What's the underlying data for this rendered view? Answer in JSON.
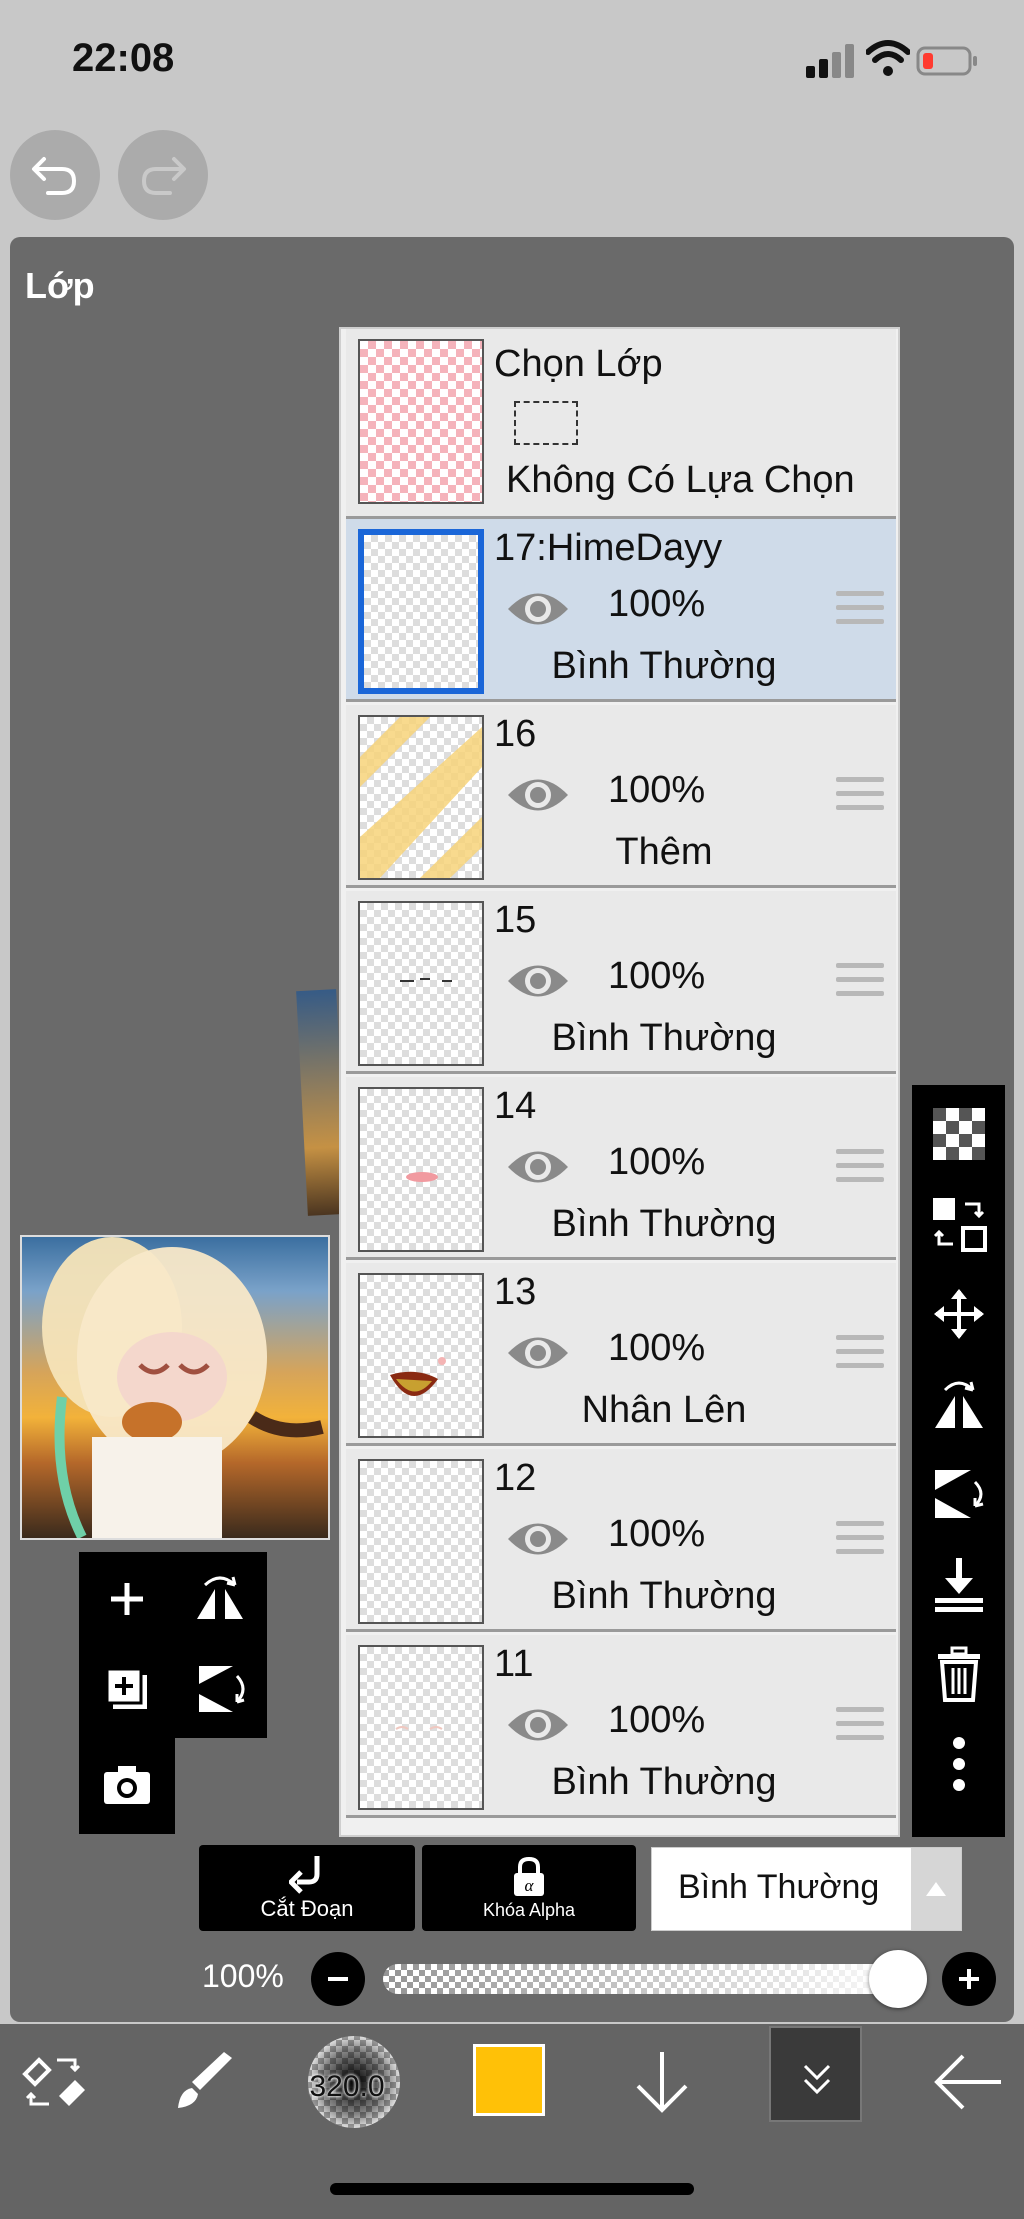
{
  "status_bar": {
    "time": "22:08",
    "battery_color": "#ff3b30"
  },
  "undo_redo": {
    "undo_icon": "undo-icon",
    "redo_icon": "redo-icon"
  },
  "panel": {
    "title": "Lớp"
  },
  "selection_layer": {
    "title": "Chọn Lớp",
    "status": "Không Có Lựa Chọn"
  },
  "layers": [
    {
      "name": "17:HimeDayy",
      "opacity": "100%",
      "mode": "Bình Thường",
      "selected": true
    },
    {
      "name": "16",
      "opacity": "100%",
      "mode": "Thêm",
      "selected": false
    },
    {
      "name": "15",
      "opacity": "100%",
      "mode": "Bình Thường",
      "selected": false
    },
    {
      "name": "14",
      "opacity": "100%",
      "mode": "Bình Thường",
      "selected": false
    },
    {
      "name": "13",
      "opacity": "100%",
      "mode": "Nhân Lên",
      "selected": false
    },
    {
      "name": "12",
      "opacity": "100%",
      "mode": "Bình Thường",
      "selected": false
    },
    {
      "name": "11",
      "opacity": "100%",
      "mode": "Bình Thường",
      "selected": false
    }
  ],
  "controls": {
    "clip_label": "Cắt Đoạn",
    "alpha_label": "Khóa Alpha",
    "blend_mode": "Bình Thường",
    "opacity_label": "100%",
    "opacity_value": 1.0
  },
  "bottom_bar": {
    "brush_size": "320.0",
    "color": "#ffc107"
  },
  "accent_color": "#1a66d8"
}
